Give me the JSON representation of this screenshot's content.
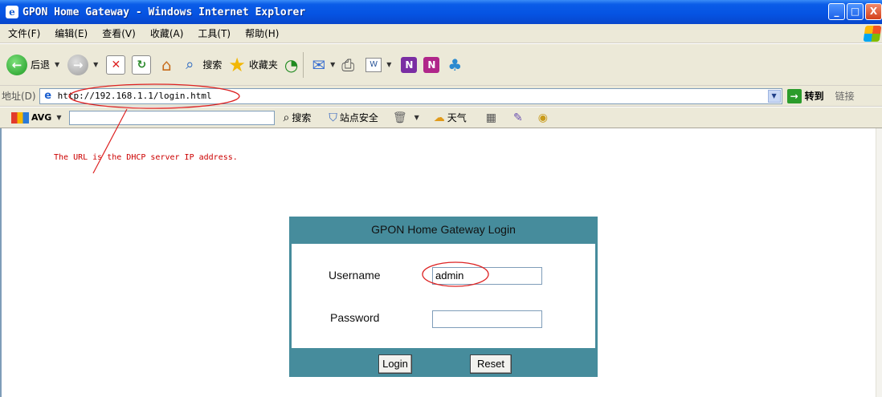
{
  "window": {
    "title": "GPON Home Gateway - Windows Internet Explorer",
    "controls": [
      "_",
      "□",
      "X"
    ]
  },
  "menubar": {
    "items": [
      "文件(F)",
      "编辑(E)",
      "查看(V)",
      "收藏(A)",
      "工具(T)",
      "帮助(H)"
    ]
  },
  "toolbar": {
    "back_label": "后退",
    "search_label": "搜索",
    "favorites_label": "收藏夹"
  },
  "address": {
    "label": "地址(D)",
    "url": "http://192.168.1.1/login.html",
    "go_label": "转到",
    "links_label": "链接"
  },
  "avg_toolbar": {
    "brand": "AVG",
    "search_label": "搜索",
    "site_safety_label": "站点安全",
    "weather_label": "天气"
  },
  "annotation": {
    "text": "The URL is the DHCP server IP address.",
    "color": "#cc0000"
  },
  "login": {
    "title": "GPON Home Gateway Login",
    "username_label": "Username",
    "username_value": "admin",
    "password_label": "Password",
    "password_value": "",
    "login_button": "Login",
    "reset_button": "Reset",
    "panel_color": "#468c9c"
  }
}
